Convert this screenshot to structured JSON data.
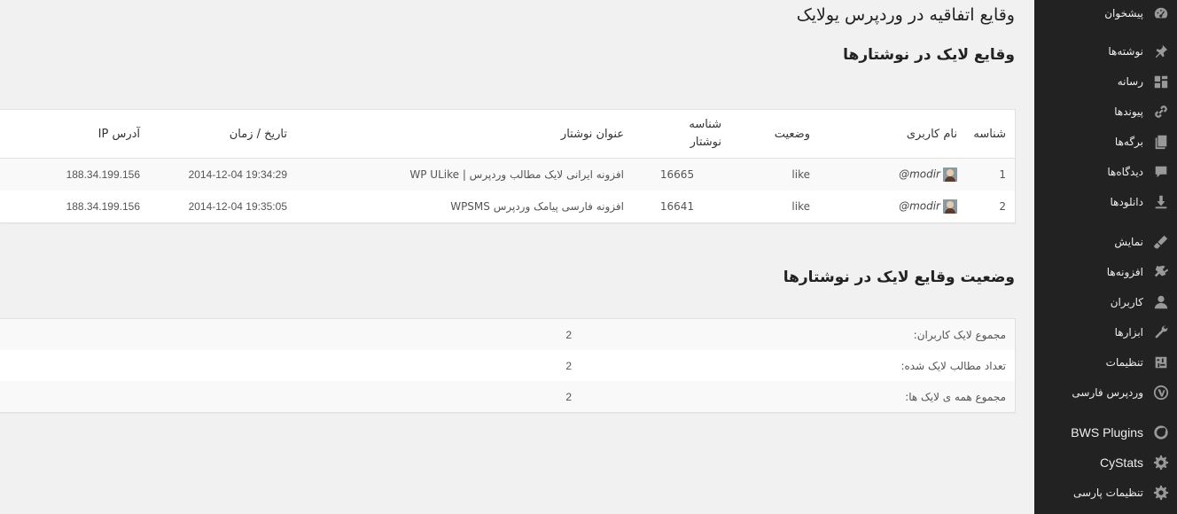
{
  "sidebar": {
    "items": [
      {
        "label": "پیشخوان",
        "icon": "dashboard-icon"
      },
      {
        "label": "نوشته‌ها",
        "icon": "pin-icon"
      },
      {
        "label": "رسانه",
        "icon": "media-icon"
      },
      {
        "label": "پیوندها",
        "icon": "link-icon"
      },
      {
        "label": "برگه‌ها",
        "icon": "pages-icon"
      },
      {
        "label": "دیدگاه‌ها",
        "icon": "comment-icon"
      },
      {
        "label": "دانلودها",
        "icon": "download-icon"
      },
      {
        "label": "نمایش",
        "icon": "appearance-icon"
      },
      {
        "label": "افزونه‌ها",
        "icon": "plugin-icon"
      },
      {
        "label": "کاربران",
        "icon": "user-icon"
      },
      {
        "label": "ابزارها",
        "icon": "wrench-icon"
      },
      {
        "label": "تنظیمات",
        "icon": "settings-icon"
      },
      {
        "label": "وردپرس فارسی",
        "icon": "wordpress-icon"
      },
      {
        "label": "BWS Plugins",
        "icon": "bws-icon"
      },
      {
        "label": "CyStats",
        "icon": "gear-icon"
      },
      {
        "label": "تنظیمات پارسی",
        "icon": "gear-icon"
      }
    ]
  },
  "page": {
    "title": "وقایع اتفاقیه در وردپرس یولایک",
    "posts_likes_title": "وقایع لایک در نوشتارها",
    "stats_title": "وضعیت وقایع لایک در نوشتارها"
  },
  "likes_table": {
    "headers": {
      "id": "شناسه",
      "username": "نام کاربری",
      "status": "وضعیت",
      "post_id": "شناسه نوشتار",
      "post_title": "عنوان نوشتار",
      "datetime": "تاریخ / زمان",
      "ip": "آدرس IP"
    },
    "rows": [
      {
        "id": "1",
        "username": "modir@",
        "status": "like",
        "post_id": "16665",
        "post_title": "افزونه ایرانی لایک مطالب وردپرس | WP ULike",
        "datetime": "2014-12-04 19:34:29",
        "ip": "188.34.199.156"
      },
      {
        "id": "2",
        "username": "modir@",
        "status": "like",
        "post_id": "16641",
        "post_title": "افزونه فارسی پیامک وردپرس WPSMS",
        "datetime": "2014-12-04 19:35:05",
        "ip": "188.34.199.156"
      }
    ]
  },
  "stats_table": {
    "rows": [
      {
        "label": "مجموع لایک کاربران:",
        "value": "2"
      },
      {
        "label": "تعداد مطالب لایک شده:",
        "value": "2"
      },
      {
        "label": "مجموع همه ی لایک ها:",
        "value": "2"
      }
    ]
  },
  "colors": {
    "sidebar_bg": "#222222",
    "content_bg": "#f1f1f1",
    "icon": "#999999"
  }
}
